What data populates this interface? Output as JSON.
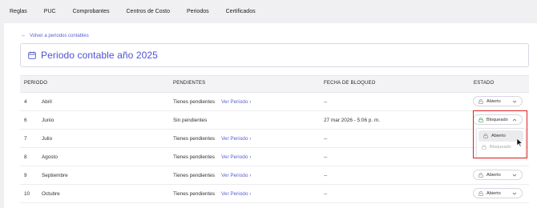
{
  "nav": {
    "tabs": [
      "Reglas",
      "PUC",
      "Comprobantes",
      "Centros de Costo",
      "Periodos",
      "Certificados"
    ]
  },
  "back_link": "Volver a periodos contables",
  "page_title": "Periodo contable año 2025",
  "table": {
    "headers": {
      "periodo": "PERIODO",
      "pendientes": "PENDIENTES",
      "fecha": "FECHA DE BLOQUEO",
      "estado": "ESTADO"
    },
    "rows": [
      {
        "num": "4",
        "month": "Abril",
        "pending": "Tienes pendientes",
        "link": "Ver Periodo",
        "date": "--",
        "status": "Abierto"
      },
      {
        "num": "6",
        "month": "Junio",
        "pending": "Sin pendientes",
        "link": "",
        "date": "27 mar 2026 - 5:06 p. m.",
        "status": "Bloqueado"
      },
      {
        "num": "7",
        "month": "Julio",
        "pending": "Tienes pendientes",
        "link": "Ver Periodo",
        "date": "--",
        "status": ""
      },
      {
        "num": "8",
        "month": "Agosto",
        "pending": "Tienes pendientes",
        "link": "Ver Periodo",
        "date": "--",
        "status": ""
      },
      {
        "num": "9",
        "month": "Septiembre",
        "pending": "Tienes pendientes",
        "link": "Ver Periodo",
        "date": "--",
        "status": "Abierto"
      },
      {
        "num": "10",
        "month": "Octubre",
        "pending": "Tienes pendientes",
        "link": "Ver Periodo",
        "date": "--",
        "status": "Abierto"
      }
    ]
  },
  "dropdown": {
    "options": [
      "Abierto",
      "Bloqueado"
    ]
  },
  "colors": {
    "accent": "#4b52d6",
    "link": "#5a5fd0",
    "open_lock": "#888888",
    "locked_lock": "#3aa55a",
    "highlight": "#e02020"
  }
}
